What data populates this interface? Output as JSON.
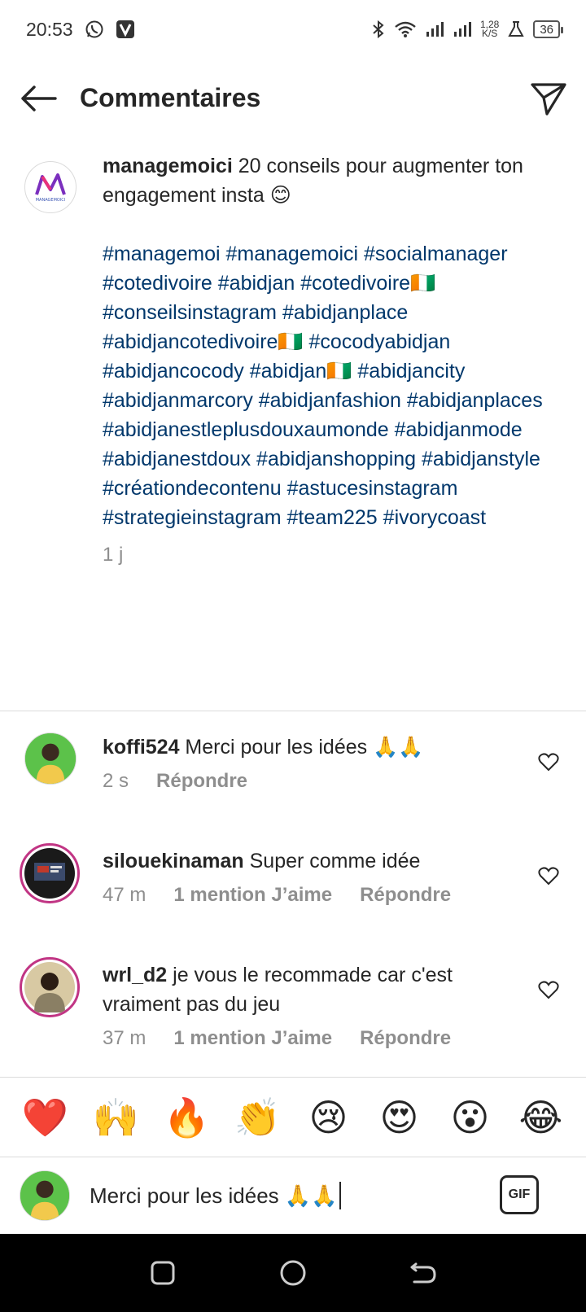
{
  "status_bar": {
    "time": "20:53",
    "net_speed_top": "1,28",
    "net_speed_bottom": "K/S",
    "battery": "36"
  },
  "header": {
    "title": "Commentaires"
  },
  "caption": {
    "username": "managemoici",
    "text": " 20 conseils pour augmenter ton engagement insta 😊",
    "hashtags": [
      "#managemoi",
      "#managemoici",
      "#socialmanager",
      "#cotedivoire",
      "#abidjan",
      "#cotedivoire🇨🇮",
      "#conseilsinstagram",
      "#abidjanplace",
      "#abidjancotedivoire🇨🇮",
      "#cocodyabidjan",
      "#abidjancocody",
      "#abidjan🇨🇮",
      "#abidjancity",
      "#abidjanmarcory",
      "#abidjanfashion",
      "#abidjanplaces",
      "#abidjanestleplusdouxaumonde",
      "#abidjanmode",
      "#abidjanestdoux",
      "#abidjanshopping",
      "#abidjanstyle",
      "#créationdecontenu",
      "#astucesinstagram",
      "#strategieinstagram",
      "#team225",
      "#ivorycoast"
    ],
    "time": "1 j",
    "avatar_label": "MANAGEMOICI"
  },
  "comments": [
    {
      "username": "koffi524",
      "text": " Merci pour les idées 🙏🙏",
      "time": "2 s",
      "likes": "",
      "reply": "Répondre"
    },
    {
      "username": "silouekinaman",
      "text": " Super comme idée",
      "time": "47 m",
      "likes": "1 mention J’aime",
      "reply": "Répondre"
    },
    {
      "username": "wrl_d2",
      "text": " je vous le recommade car c'est vraiment pas du jeu",
      "time": "37 m",
      "likes": "1 mention J’aime",
      "reply": "Répondre"
    }
  ],
  "emoji_bar": [
    "❤️",
    "🙌",
    "🔥",
    "👏",
    "😢",
    "😍",
    "😮",
    "😂"
  ],
  "input": {
    "value": "Merci pour les idées 🙏🙏",
    "gif_label": "GIF"
  },
  "colors": {
    "hashtag": "#00376b",
    "secondary": "#8e8e8e",
    "story_ring": "#c13584"
  }
}
